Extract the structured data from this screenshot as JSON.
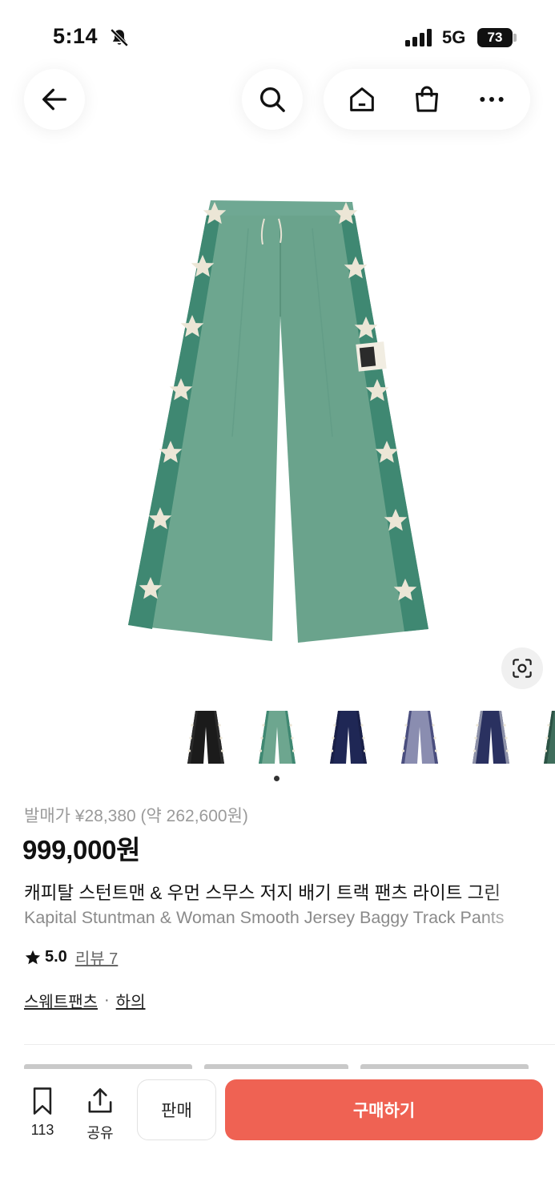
{
  "status_bar": {
    "time": "5:14",
    "network": "5G",
    "battery": "73"
  },
  "product": {
    "release_price": "발매가 ¥28,380 (약 262,600원)",
    "price": "999,000원",
    "title_ko": "캐피탈 스턴트맨 & 우먼 스무스 저지 배기 트랙 팬츠 라이트 그린",
    "title_en": "Kapital Stuntman & Woman Smooth Jersey Baggy Track Pants",
    "rating": "5.0",
    "review_label": "리뷰 7",
    "category": "스웨트팬츠",
    "subcategory": "하의",
    "category_separator": "·",
    "colors": {
      "pants_green": "#6da68f",
      "pants_stripe": "#3f8872",
      "accent_red": "#ef6253"
    }
  },
  "thumbnails": [
    {
      "name": "black",
      "color": "#1b1b1b",
      "stripe": "#2a2a2a"
    },
    {
      "name": "light-green",
      "color": "#6da68f",
      "stripe": "#3f8872"
    },
    {
      "name": "navy",
      "color": "#1f2755",
      "stripe": "#1a2048"
    },
    {
      "name": "purple-grey",
      "color": "#8a8db0",
      "stripe": "#4a4e7e"
    },
    {
      "name": "navy-grey",
      "color": "#2a3160",
      "stripe": "#8d91a8"
    },
    {
      "name": "green-partial",
      "color": "#3f6e5c",
      "stripe": "#2c5345"
    }
  ],
  "bottom_bar": {
    "bookmark_count": "113",
    "share_label": "공유",
    "sell_label": "판매",
    "buy_label": "구매하기"
  }
}
